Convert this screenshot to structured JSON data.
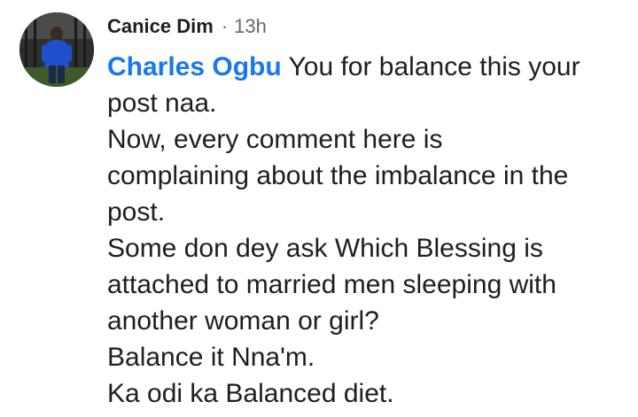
{
  "comment": {
    "author": "Canice Dim",
    "separator": "·",
    "time": "13h",
    "mention": "Charles Ogbu",
    "lines": [
      "You for balance this your",
      "post naa.",
      "Now, every comment here is",
      "complaining about the imbalance in the",
      "post.",
      "Some don dey ask Which Blessing is",
      "attached to married men sleeping with",
      "another woman or girl?",
      "Balance it Nna'm.",
      "Ka odi ka Balanced diet."
    ]
  },
  "avatar": {
    "icon": "profile-photo",
    "shirt_color": "#1f4fc9",
    "background_color": "#2b2b2b"
  },
  "colors": {
    "mention": "#1877f2",
    "text": "#1c1e21",
    "meta": "#65676b"
  }
}
